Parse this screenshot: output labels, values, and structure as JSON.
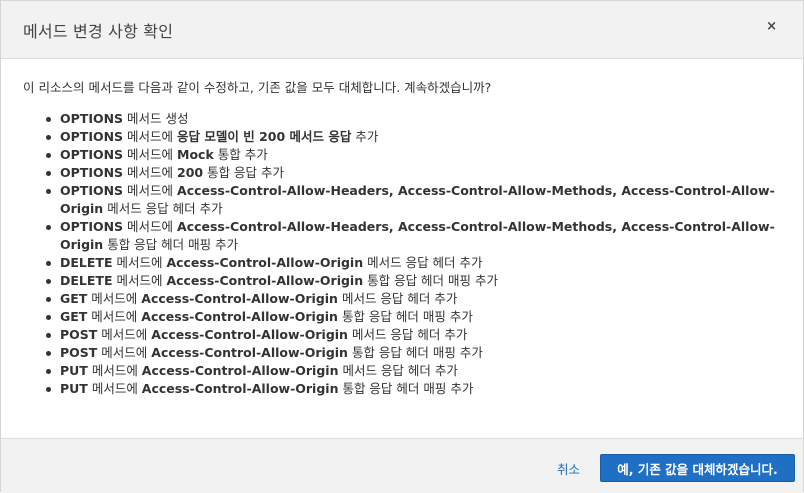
{
  "dialog": {
    "title": "메서드 변경 사항 확인",
    "close_label": "×"
  },
  "body": {
    "intro": "이 리소스의 메서드를 다음과 같이 수정하고, 기존 값을 모두 대체합니다. 계속하겠습니까?",
    "items": [
      [
        {
          "t": "OPTIONS",
          "b": true
        },
        {
          "t": " 메서드 생성",
          "b": false
        }
      ],
      [
        {
          "t": "OPTIONS",
          "b": true
        },
        {
          "t": " 메서드에 ",
          "b": false
        },
        {
          "t": "응답 모델이 빈 200 메서드 응답",
          "b": true
        },
        {
          "t": " 추가",
          "b": false
        }
      ],
      [
        {
          "t": "OPTIONS",
          "b": true
        },
        {
          "t": " 메서드에 ",
          "b": false
        },
        {
          "t": "Mock",
          "b": true
        },
        {
          "t": " 통합 추가",
          "b": false
        }
      ],
      [
        {
          "t": "OPTIONS",
          "b": true
        },
        {
          "t": " 메서드에 ",
          "b": false
        },
        {
          "t": "200",
          "b": true
        },
        {
          "t": " 통합 응답 추가",
          "b": false
        }
      ],
      [
        {
          "t": "OPTIONS",
          "b": true
        },
        {
          "t": " 메서드에 ",
          "b": false
        },
        {
          "t": "Access-Control-Allow-Headers, Access-Control-Allow-Methods, Access-Control-Allow-Origin",
          "b": true
        },
        {
          "t": " 메서드 응답 헤더 추가",
          "b": false
        }
      ],
      [
        {
          "t": "OPTIONS",
          "b": true
        },
        {
          "t": " 메서드에 ",
          "b": false
        },
        {
          "t": "Access-Control-Allow-Headers, Access-Control-Allow-Methods, Access-Control-Allow-Origin",
          "b": true
        },
        {
          "t": " 통합 응답 헤더 매핑 추가",
          "b": false
        }
      ],
      [
        {
          "t": "DELETE",
          "b": true
        },
        {
          "t": " 메서드에 ",
          "b": false
        },
        {
          "t": "Access-Control-Allow-Origin",
          "b": true
        },
        {
          "t": " 메서드 응답 헤더 추가",
          "b": false
        }
      ],
      [
        {
          "t": "DELETE",
          "b": true
        },
        {
          "t": " 메서드에 ",
          "b": false
        },
        {
          "t": "Access-Control-Allow-Origin",
          "b": true
        },
        {
          "t": " 통합 응답 헤더 매핑 추가",
          "b": false
        }
      ],
      [
        {
          "t": "GET",
          "b": true
        },
        {
          "t": " 메서드에 ",
          "b": false
        },
        {
          "t": "Access-Control-Allow-Origin",
          "b": true
        },
        {
          "t": " 메서드 응답 헤더 추가",
          "b": false
        }
      ],
      [
        {
          "t": "GET",
          "b": true
        },
        {
          "t": " 메서드에 ",
          "b": false
        },
        {
          "t": "Access-Control-Allow-Origin",
          "b": true
        },
        {
          "t": " 통합 응답 헤더 매핑 추가",
          "b": false
        }
      ],
      [
        {
          "t": "POST",
          "b": true
        },
        {
          "t": " 메서드에 ",
          "b": false
        },
        {
          "t": "Access-Control-Allow-Origin",
          "b": true
        },
        {
          "t": " 메서드 응답 헤더 추가",
          "b": false
        }
      ],
      [
        {
          "t": "POST",
          "b": true
        },
        {
          "t": " 메서드에 ",
          "b": false
        },
        {
          "t": "Access-Control-Allow-Origin",
          "b": true
        },
        {
          "t": " 통합 응답 헤더 매핑 추가",
          "b": false
        }
      ],
      [
        {
          "t": "PUT",
          "b": true
        },
        {
          "t": " 메서드에 ",
          "b": false
        },
        {
          "t": "Access-Control-Allow-Origin",
          "b": true
        },
        {
          "t": " 메서드 응답 헤더 추가",
          "b": false
        }
      ],
      [
        {
          "t": "PUT",
          "b": true
        },
        {
          "t": " 메서드에 ",
          "b": false
        },
        {
          "t": "Access-Control-Allow-Origin",
          "b": true
        },
        {
          "t": " 통합 응답 헤더 매핑 추가",
          "b": false
        }
      ]
    ]
  },
  "footer": {
    "cancel_label": "취소",
    "confirm_label": "예, 기존 값을 대체하겠습니다."
  }
}
